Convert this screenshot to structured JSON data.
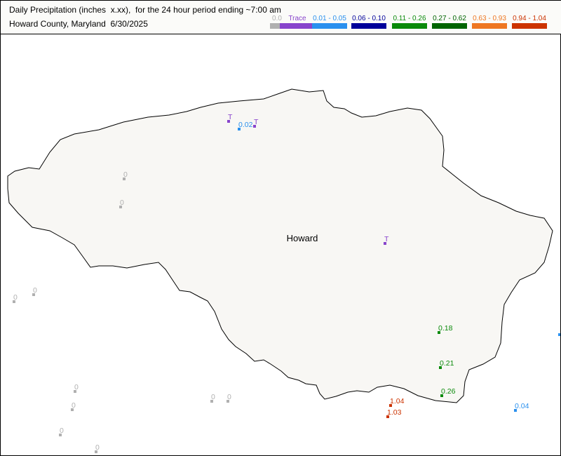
{
  "header": {
    "title_line1": "Daily Precipitation (inches  x.xx),  for the 24 hour period ending ~7:00 am",
    "title_line2": "Howard County, Maryland  6/30/2025"
  },
  "legend": [
    {
      "label": "0.0",
      "color": "#b0b0b0"
    },
    {
      "label": "Trace",
      "color": "#8844cc"
    },
    {
      "label": "0.01 - 0.05",
      "color": "#2a90ee"
    },
    {
      "label": "0.06 - 0.10",
      "color": "#00009a"
    },
    {
      "label": "0.11 - 0.26",
      "color": "#0a8a0a"
    },
    {
      "label": "0.27 - 0.62",
      "color": "#006400"
    },
    {
      "label": "0.63 - 0.93",
      "color": "#ee7722"
    },
    {
      "label": "0.94 - 1.04",
      "color": "#cc3300"
    }
  ],
  "map": {
    "county_name": "Howard",
    "county_fill": "#f8f7f4",
    "stations": [
      {
        "label": "T",
        "color": "#8844cc"
      },
      {
        "label": "0.02",
        "color": "#2a90ee"
      },
      {
        "label": "T",
        "color": "#8844cc"
      },
      {
        "label": "0",
        "color": "#b0b0b0"
      },
      {
        "label": "0",
        "color": "#b0b0b0"
      },
      {
        "label": "T",
        "color": "#8844cc"
      },
      {
        "label": "0",
        "color": "#b0b0b0"
      },
      {
        "label": "0",
        "color": "#b0b0b0"
      },
      {
        "label": "0.18",
        "color": "#0a8a0a"
      },
      {
        "label": "0.21",
        "color": "#0a8a0a"
      },
      {
        "label": "0.26",
        "color": "#0a8a0a"
      },
      {
        "label": "0",
        "color": "#b0b0b0"
      },
      {
        "label": "0",
        "color": "#b0b0b0"
      },
      {
        "label": "0",
        "color": "#b0b0b0"
      },
      {
        "label": "0",
        "color": "#b0b0b0"
      },
      {
        "label": "1.04",
        "color": "#cc3300"
      },
      {
        "label": "1.03",
        "color": "#cc3300"
      },
      {
        "label": "0.04",
        "color": "#2a90ee"
      },
      {
        "label": "0",
        "color": "#b0b0b0"
      },
      {
        "label": "0",
        "color": "#b0b0b0"
      },
      {
        "label": "",
        "color": "#2a90ee"
      }
    ]
  }
}
